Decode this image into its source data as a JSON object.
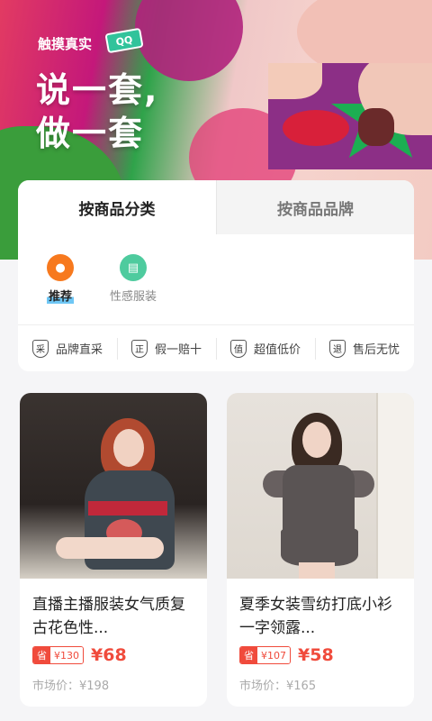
{
  "banner": {
    "brand": "触摸真实",
    "brand_icon": "QQ",
    "slogan_line1": "说一套,",
    "slogan_line2": "做一套"
  },
  "tabs": [
    {
      "label": "按商品分类",
      "active": true
    },
    {
      "label": "按商品品牌",
      "active": false
    }
  ],
  "categories": [
    {
      "label": "推荐",
      "icon": "flame-icon",
      "selected": true
    },
    {
      "label": "性感服装",
      "icon": "clipboard-icon",
      "selected": false
    }
  ],
  "features": [
    {
      "badge": "采",
      "label": "品牌直采"
    },
    {
      "badge": "正",
      "label": "假一赔十"
    },
    {
      "badge": "值",
      "label": "超值低价"
    },
    {
      "badge": "退",
      "label": "售后无忧"
    }
  ],
  "products": [
    {
      "title": "直播主播服装女气质复古花色性...",
      "save_label": "省",
      "save_amount": "¥130",
      "price": "¥68",
      "market_price": "市场价：¥198"
    },
    {
      "title": "夏季女装雪纺打底小衫一字领露...",
      "save_label": "省",
      "save_amount": "¥107",
      "price": "¥58",
      "market_price": "市场价：¥165"
    }
  ],
  "colors": {
    "accent": "#f04b3c",
    "flame": "#f7791e",
    "mint": "#4ecb9e"
  }
}
